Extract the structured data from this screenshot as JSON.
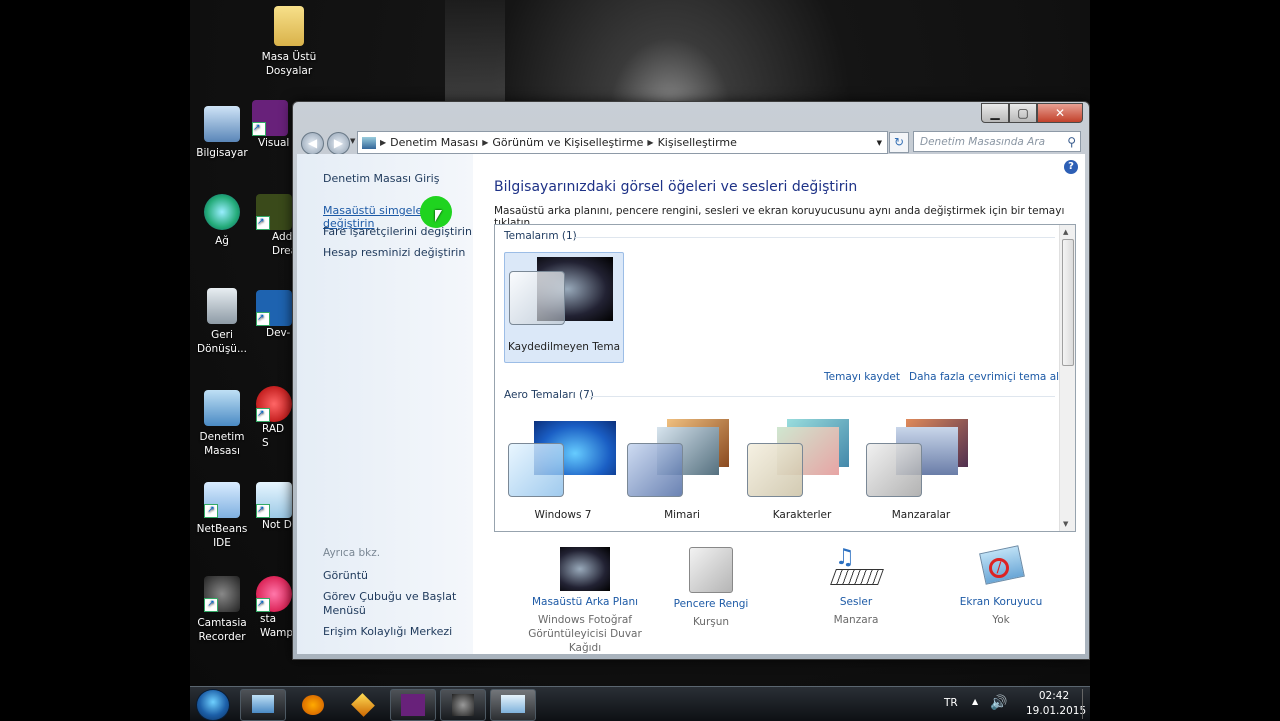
{
  "desktop": {
    "icons": [
      {
        "label": "Masa Üstü\nDosyalar"
      },
      {
        "label": "Bilgisayar"
      },
      {
        "label": "Visual"
      },
      {
        "label": "Ağ"
      },
      {
        "label": "Add\nDream"
      },
      {
        "label": "Geri\nDönüşü..."
      },
      {
        "label": "Dev-"
      },
      {
        "label": "Denetim\nMasası"
      },
      {
        "label": "RAD S"
      },
      {
        "label": "NetBeans IDE"
      },
      {
        "label": "Not D"
      },
      {
        "label": "Camtasia\nRecorder"
      },
      {
        "label": "sta\nWamp"
      }
    ]
  },
  "window": {
    "caption": {
      "minimize": "▁",
      "maximize": "▢",
      "close": "✕"
    },
    "address": [
      "Denetim Masası",
      "Görünüm ve Kişiselleştirme",
      "Kişiselleştirme"
    ],
    "search_placeholder": "Denetim Masasında Ara",
    "left_pane": {
      "home": "Denetim Masası Giriş",
      "links": [
        "Masaüstü simgelerini değiştirin",
        "Fare işaretçilerini değiştirin",
        "Hesap resminizi değiştirin"
      ],
      "see_also_title": "Ayrıca bkz.",
      "see_also": [
        "Görüntü",
        "Görev Çubuğu ve Başlat\nMenüsü",
        "Erişim Kolaylığı Merkezi"
      ]
    },
    "heading": "Bilgisayarınızdaki görsel öğeleri ve sesleri değiştirin",
    "description": "Masaüstü arka planını, pencere rengini, sesleri ve ekran koruyucusunu aynı anda değiştirmek için bir temayı tıklatın.",
    "my_themes_title": "Temalarım (1)",
    "my_themes": [
      {
        "name": "Kaydedilmeyen Tema"
      }
    ],
    "save_theme": "Temayı kaydet",
    "more_themes": "Daha fazla çevrimiçi tema al",
    "aero_title": "Aero Temaları (7)",
    "aero_themes": [
      {
        "name": "Windows 7"
      },
      {
        "name": "Mimari"
      },
      {
        "name": "Karakterler"
      },
      {
        "name": "Manzaralar"
      }
    ],
    "bottom": [
      {
        "label": "Masaüstü Arka Planı",
        "sub": "Windows Fotoğraf\nGörüntüleyicisi Duvar Kağıdı"
      },
      {
        "label": "Pencere Rengi",
        "sub": "Kurşun"
      },
      {
        "label": "Sesler",
        "sub": "Manzara"
      },
      {
        "label": "Ekran Koruyucu",
        "sub": "Yok"
      }
    ]
  },
  "taskbar": {
    "lang": "TR",
    "time": "02:42",
    "date": "19.01.2015"
  },
  "colors": {
    "accent_link": "#1d5aa6",
    "heading": "#1e3287",
    "cursor_highlight": "#1fd31f"
  }
}
